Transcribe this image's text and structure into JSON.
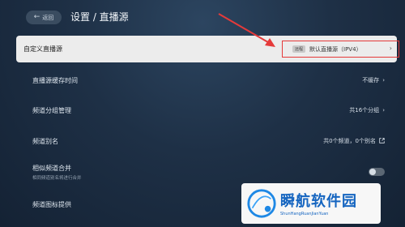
{
  "header": {
    "back_label": "返回",
    "title": "设置 / 直播源"
  },
  "rows": {
    "custom_source": {
      "label": "自定义直播源",
      "badge": "远程",
      "value": "默认直播源（IPV4）"
    },
    "cache_time": {
      "label": "直播源缓存时间",
      "value": "不缓存"
    },
    "group_manage": {
      "label": "频道分组管理",
      "value": "共16个分组"
    },
    "alias": {
      "label": "频道别名",
      "value": "共0个频道，0个别名"
    },
    "merge": {
      "label": "相似频道合并",
      "sublabel": "相同频道别名将进行合并",
      "enabled": false
    },
    "logo_provider": {
      "label": "频道图标提供"
    }
  },
  "watermark": {
    "text": "瞬航软件园",
    "subtext": "ShunHangRuanJianYuan"
  },
  "colors": {
    "highlight_box": "#e53a3a",
    "annotation_arrow": "#e53a3a",
    "watermark_blue": "#1565c0"
  }
}
